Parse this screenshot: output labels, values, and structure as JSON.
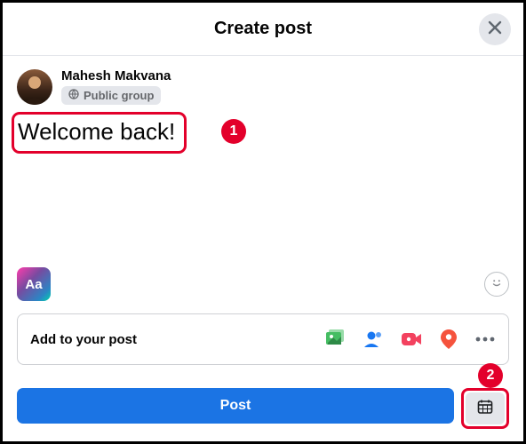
{
  "header": {
    "title": "Create post"
  },
  "user": {
    "name": "Mahesh Makvana",
    "audience_label": "Public group"
  },
  "compose": {
    "text": "Welcome back!"
  },
  "background_button": {
    "label": "Aa"
  },
  "add_row": {
    "label": "Add to your post"
  },
  "footer": {
    "post_label": "Post"
  },
  "callouts": {
    "one": "1",
    "two": "2"
  },
  "icons": {
    "close": "close-icon",
    "globe": "globe-icon",
    "bg": "background-color-icon",
    "emoji": "emoji-icon",
    "photo": "photo-video-icon",
    "tag": "tag-people-icon",
    "live": "live-video-icon",
    "location": "location-icon",
    "more": "more-icon",
    "schedule": "schedule-icon"
  }
}
